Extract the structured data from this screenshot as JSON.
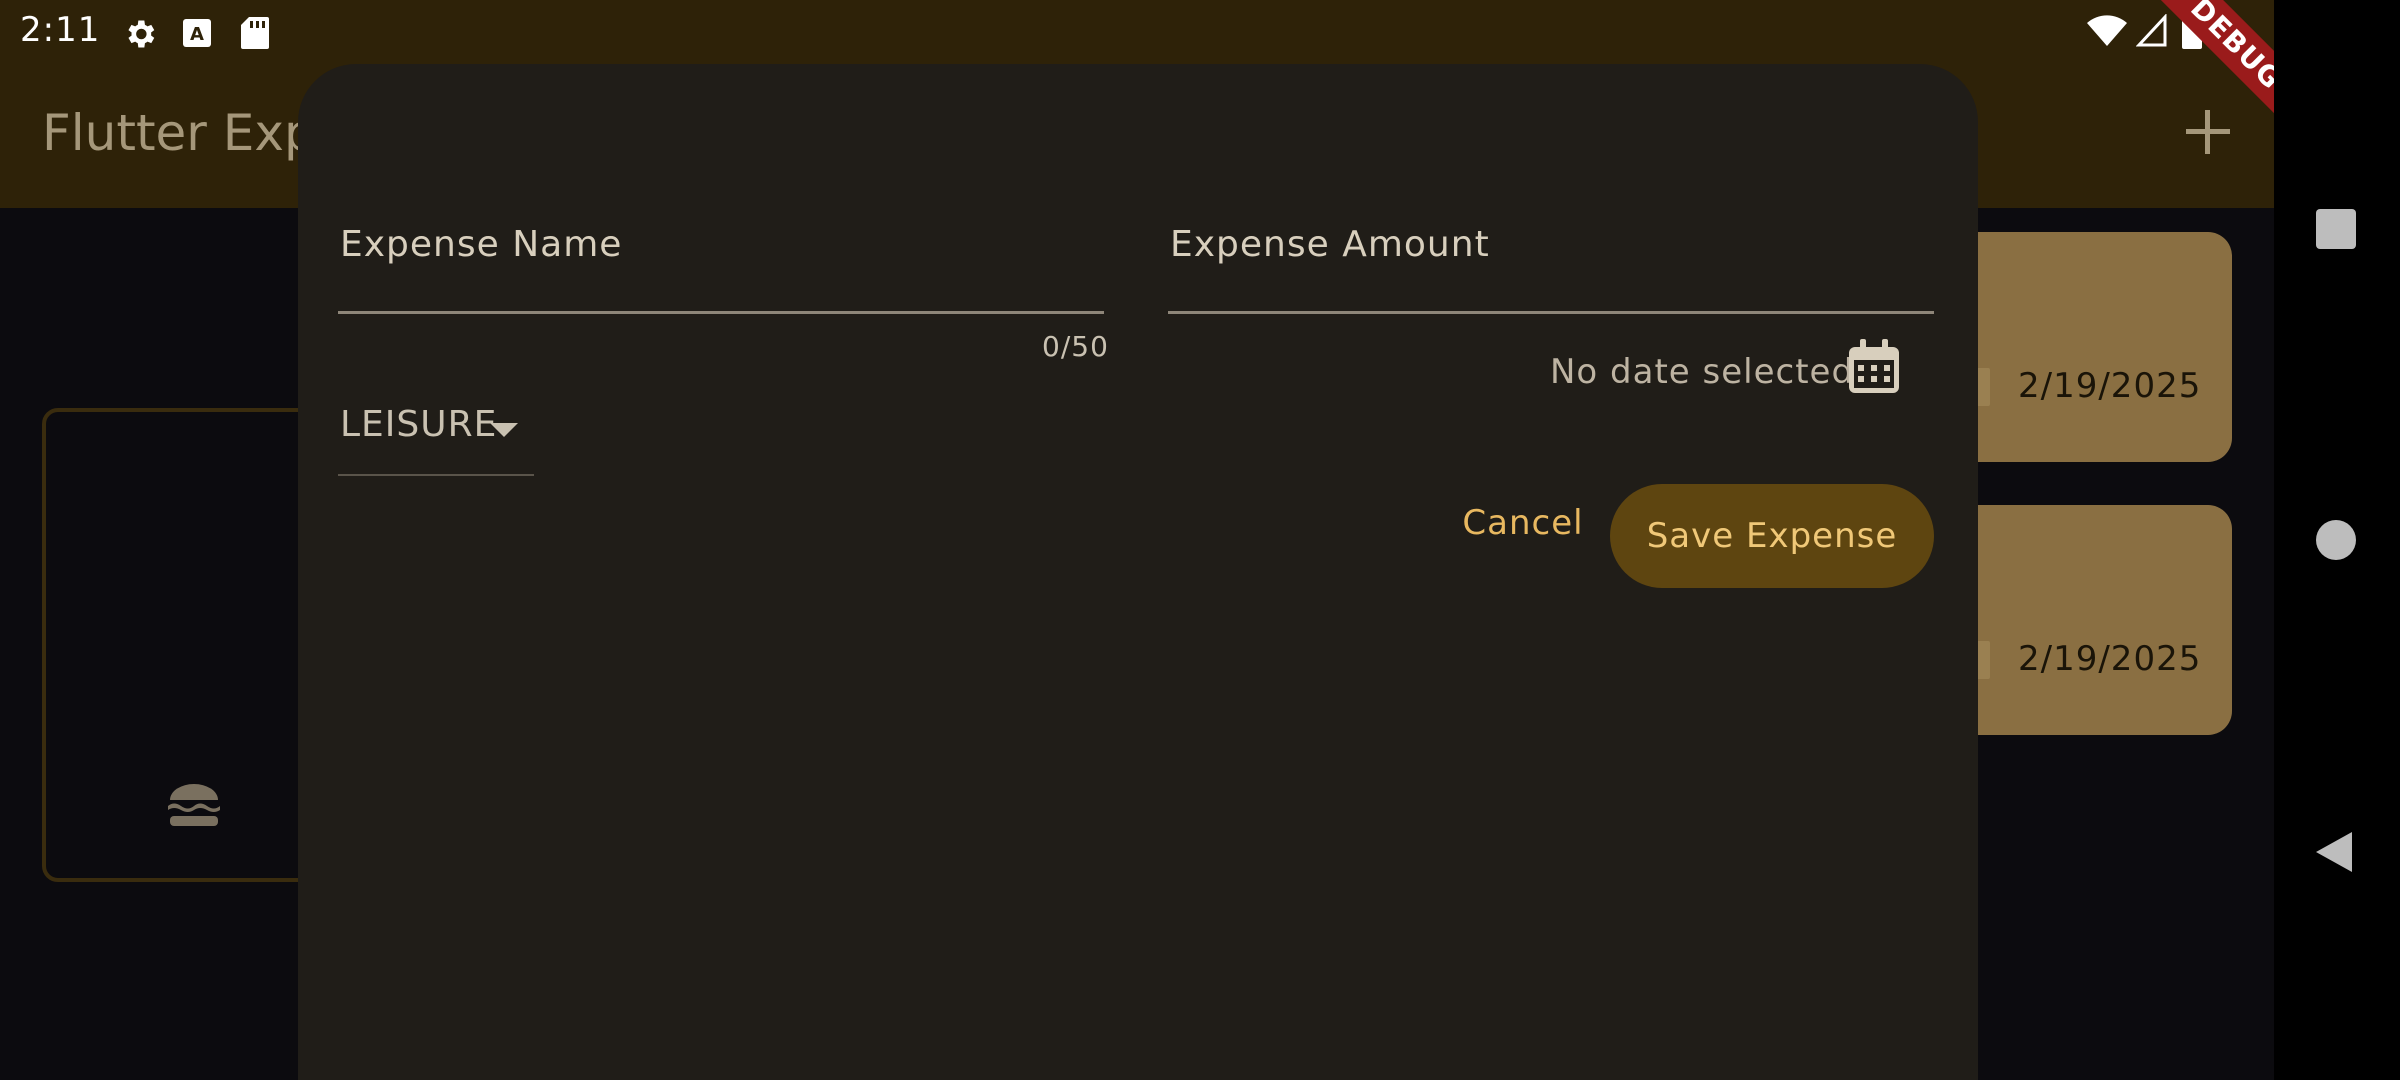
{
  "status_bar": {
    "time": "2:11",
    "icons": [
      "settings-icon",
      "a-keyboard-icon",
      "sd-card-icon",
      "wifi-icon",
      "signal-icon",
      "battery-icon"
    ]
  },
  "app_bar": {
    "title": "Flutter Expense Tracker",
    "add_icon": "plus-icon"
  },
  "debug_banner": "DEBUG",
  "background_expenses": [
    {
      "date": "2/19/2025"
    },
    {
      "date": "2/19/2025"
    }
  ],
  "chart": {
    "category_icon": "hamburger-icon"
  },
  "sheet": {
    "name_field": {
      "label": "Expense Name",
      "value": "",
      "counter": "0/50"
    },
    "amount_field": {
      "label": "Expense Amount",
      "value": ""
    },
    "category_dropdown": {
      "value": "LEISURE"
    },
    "date_status": "No date selected",
    "calendar_icon": "calendar-icon",
    "cancel_label": "Cancel",
    "save_label": "Save Expense"
  },
  "colors": {
    "app_bar": "#2e2208",
    "sheet": "#201d18",
    "accent": "#e8b860",
    "primary_button": "#5e4510",
    "card": "#8a6f42",
    "debug": "#9a1b1b"
  }
}
